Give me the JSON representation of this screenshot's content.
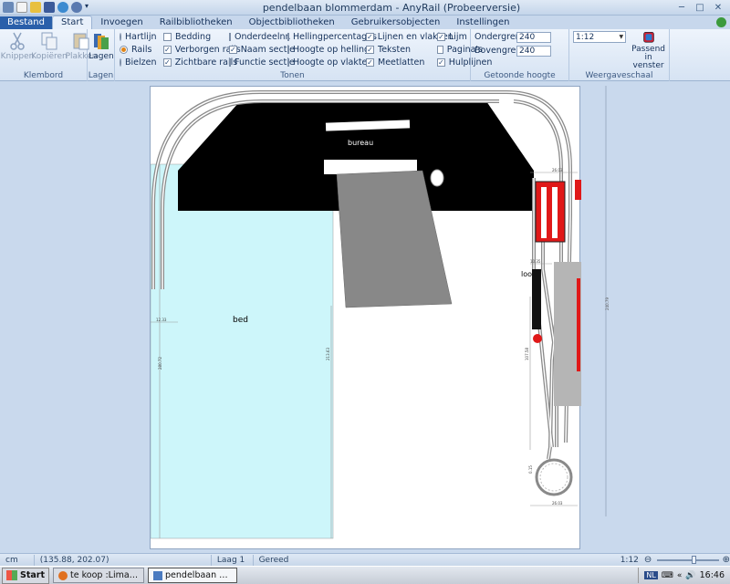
{
  "window": {
    "title": "pendelbaan blommerdam - AnyRail (Probeerversie)"
  },
  "tabs": [
    "Bestand",
    "Start",
    "Invoegen",
    "Railbibliotheken",
    "Objectbibliotheken",
    "Gebruikersobjecten",
    "Instellingen"
  ],
  "ribbon": {
    "klembord": {
      "label": "Klembord",
      "knippen": "Knippen",
      "kopieren": "Kopiëren",
      "plakken": "Plakken"
    },
    "lagen": {
      "label": "Lagen",
      "button": "Lagen"
    },
    "tonen": {
      "label": "Tonen",
      "col1": [
        "Hartlijn",
        "Rails",
        "Bielzen"
      ],
      "col2": [
        "Bedding",
        "Verborgen rails",
        "Zichtbare rails"
      ],
      "col3": [
        "Onderdeelnr.",
        "Naam sectie",
        "Functie sectie"
      ],
      "col4": [
        "Hellingpercentages",
        "Hoogte op helling",
        "Hoogte op vlaktes"
      ],
      "col5": [
        "Lijnen en vlakken",
        "Teksten",
        "Meetlatten"
      ],
      "col6": [
        "Lijm",
        "Pagina's",
        "Hulplijnen"
      ]
    },
    "getoonde_hoogte": {
      "label": "Getoonde hoogte",
      "ondergrens_label": "Ondergrens",
      "ondergrens_value": "240",
      "bovengrens_label": "Bovengrens",
      "bovengrens_value": "240"
    },
    "weergaveschaal": {
      "label": "Weergaveschaal",
      "scale": "1:12",
      "fit_button": "Passend in venster"
    }
  },
  "canvas": {
    "labels": {
      "bureau": "bureau",
      "bed": "bed",
      "loo": "loo"
    },
    "dimensions": {
      "top_width": "26.03",
      "top_width2": "26.03",
      "bottom_width": "26.03",
      "small1": "12.33",
      "small2": "10.35",
      "height_left": "280.72",
      "height_mid": "213.63",
      "height_right": "107.58",
      "height_far": "240.79",
      "height_small": "0.15"
    }
  },
  "statusbar": {
    "unit": "cm",
    "coords": "(135.88, 202.07)",
    "layer": "Laag 1",
    "status": "Gereed",
    "zoom": "1:12"
  },
  "taskbar": {
    "start": "Start",
    "task1": "te koop :Lima DDM met bi...",
    "task2": "pendelbaan blommerdam ...",
    "lang": "NL",
    "time": "16:46"
  },
  "colors": {
    "ribbon_blue": "#2a5faa",
    "bed_fill": "#cdf6fa",
    "desk_fill": "#000000",
    "chair_fill": "#888888",
    "signal_red": "#e01818",
    "track_gray": "#8a8a8a"
  }
}
